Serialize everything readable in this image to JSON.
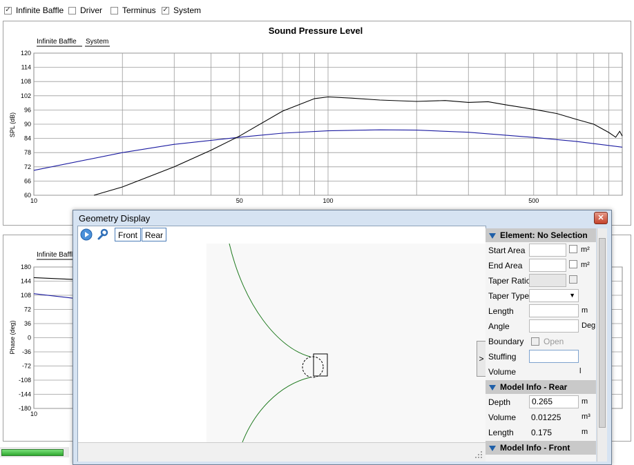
{
  "toolbar": {
    "checkboxes": [
      {
        "label": "Infinite Baffle",
        "checked": true
      },
      {
        "label": "Driver",
        "checked": false
      },
      {
        "label": "Terminus",
        "checked": false
      },
      {
        "label": "System",
        "checked": true
      }
    ],
    "check_glyph": "✓"
  },
  "spl_chart": {
    "tabs": [
      "Infinite Baffle",
      "System"
    ]
  },
  "phase_chart": {
    "tabs": [
      "Infinite Baffle"
    ]
  },
  "chart_data": [
    {
      "type": "line",
      "title": "Sound Pressure Level",
      "ylabel": "SPL (dB)",
      "xlabel": "",
      "x_scale": "log",
      "xlim": [
        10,
        1000
      ],
      "ylim": [
        60,
        120
      ],
      "xticks": [
        10,
        50,
        100,
        500
      ],
      "yticks": [
        60,
        66,
        72,
        78,
        84,
        90,
        96,
        102,
        108,
        114,
        120
      ],
      "grid": true,
      "series": [
        {
          "color": "#1a1aa0",
          "x": [
            10,
            20,
            30,
            50,
            70,
            100,
            150,
            200,
            300,
            500,
            700,
            1000
          ],
          "y": [
            70.5,
            78,
            81.5,
            84.5,
            86.2,
            87.2,
            87.6,
            87.5,
            86.6,
            84.4,
            82.7,
            80.3
          ]
        },
        {
          "color": "#000000",
          "x": [
            16,
            20,
            30,
            40,
            50,
            70,
            90,
            100,
            120,
            150,
            200,
            250,
            300,
            350,
            400,
            500,
            600,
            700,
            800,
            900,
            950,
            980,
            1000
          ],
          "y": [
            60,
            63.5,
            72,
            79,
            85,
            95.5,
            100.8,
            101.5,
            101,
            100.2,
            99.6,
            100,
            99.2,
            99.5,
            98.2,
            96.3,
            94.5,
            92,
            90,
            86.5,
            84.5,
            87,
            85
          ]
        }
      ]
    },
    {
      "type": "line",
      "title": "",
      "ylabel": "Phase (deg)",
      "x_scale": "log",
      "xlim": [
        10,
        1000
      ],
      "ylim": [
        -180,
        180
      ],
      "xticks": [
        10
      ],
      "yticks": [
        -180,
        -144,
        -108,
        -72,
        -36,
        0,
        36,
        72,
        108,
        144,
        180
      ],
      "grid": true,
      "series": [
        {
          "color": "#000000",
          "x": [
            10,
            15
          ],
          "y": [
            153,
            147
          ]
        },
        {
          "color": "#1a1aa0",
          "x": [
            10,
            15
          ],
          "y": [
            112,
            97
          ]
        }
      ]
    }
  ],
  "geometry_dialog": {
    "title": "Geometry Display",
    "close_label": "✕",
    "play_icon": "play-icon",
    "wrench_icon": "wrench-icon",
    "tab_front": "Front",
    "tab_rear": "Rear",
    "expander_label": ">",
    "element_header": "Element: No Selection",
    "rows": {
      "start_area": "Start Area",
      "end_area": "End Area",
      "taper_ratio": "Taper Ratio",
      "taper_type": "Taper Type",
      "length": "Length",
      "angle": "Angle",
      "boundary": "Boundary",
      "open": "Open",
      "stuffing": "Stuffing",
      "volume": "Volume"
    },
    "units": {
      "area": "m²",
      "length": "m",
      "angle": "Deg",
      "volume_short": "l"
    },
    "rear_header": "Model Info - Rear",
    "rear": {
      "depth_label": "Depth",
      "depth_value": "0.265",
      "depth_unit": "m",
      "volume_label": "Volume",
      "volume_value": "0.01225",
      "volume_unit": "m³",
      "length_label": "Length",
      "length_value": "0.175",
      "length_unit": "m"
    },
    "front_header": "Model Info - Front"
  }
}
